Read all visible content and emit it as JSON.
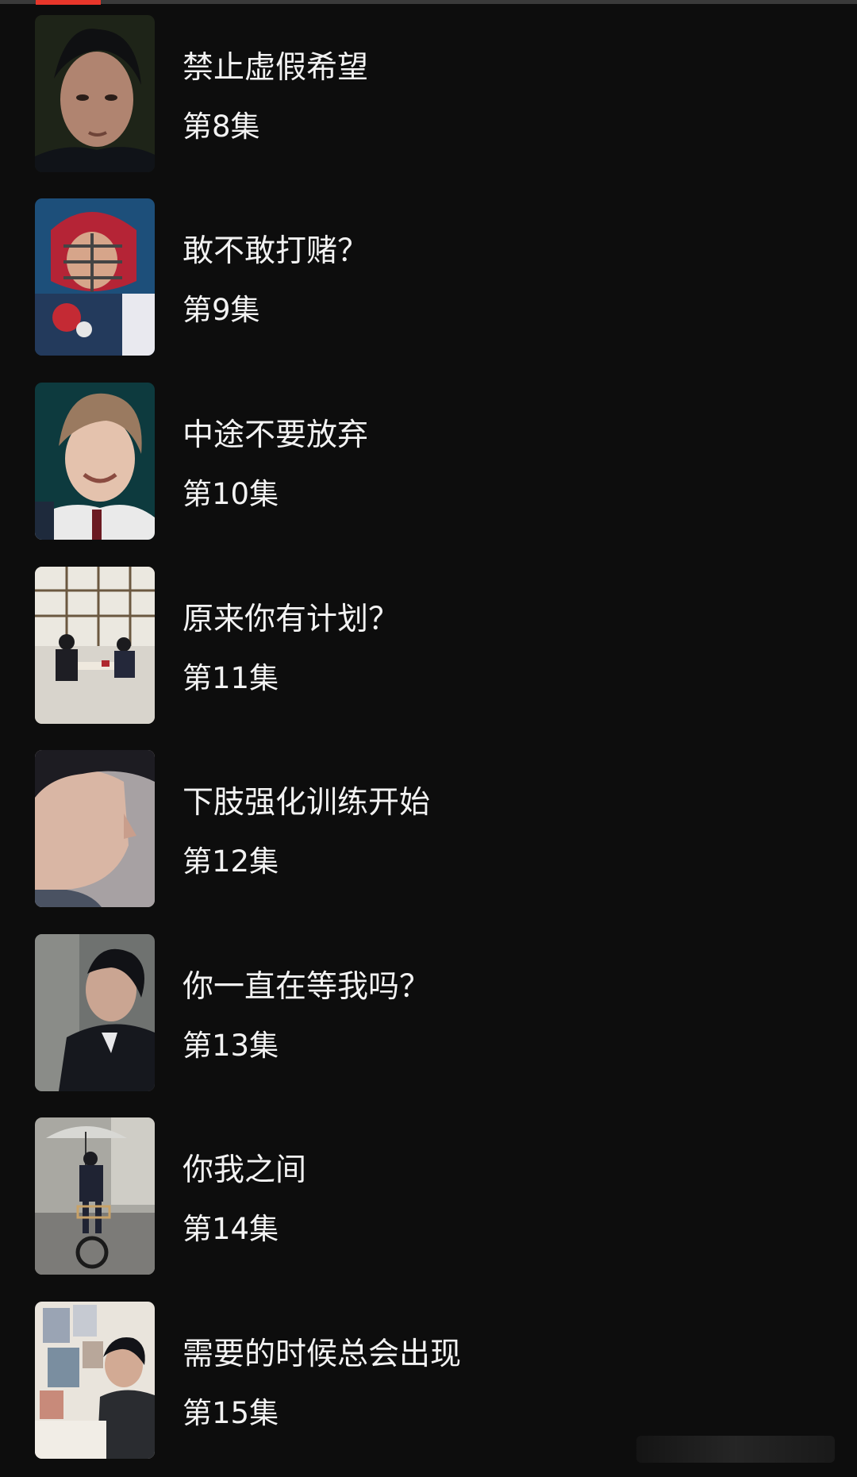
{
  "episodes": [
    {
      "title": "禁止虚假希望",
      "number": "第8集",
      "thumb": "close-up-portrait-thumbnail"
    },
    {
      "title": "敢不敢打赌？",
      "number": "第9集",
      "thumb": "catcher-mask-thumbnail"
    },
    {
      "title": "中途不要放弃",
      "number": "第10集",
      "thumb": "smiling-student-thumbnail"
    },
    {
      "title": "原来你有计划？",
      "number": "第11集",
      "thumb": "classroom-scene-thumbnail"
    },
    {
      "title": "下肢强化训练开始",
      "number": "第12集",
      "thumb": "profile-portrait-thumbnail"
    },
    {
      "title": "你一直在等我吗？",
      "number": "第13集",
      "thumb": "looking-up-thumbnail"
    },
    {
      "title": "你我之间",
      "number": "第14集",
      "thumb": "bicycle-umbrella-thumbnail"
    },
    {
      "title": "需要的时候总会出现",
      "number": "第15集",
      "thumb": "bedroom-poster-thumbnail"
    }
  ],
  "colors": {
    "background": "#0d0d0d",
    "accent": "#e8362a",
    "text": "#f2f2f2"
  }
}
